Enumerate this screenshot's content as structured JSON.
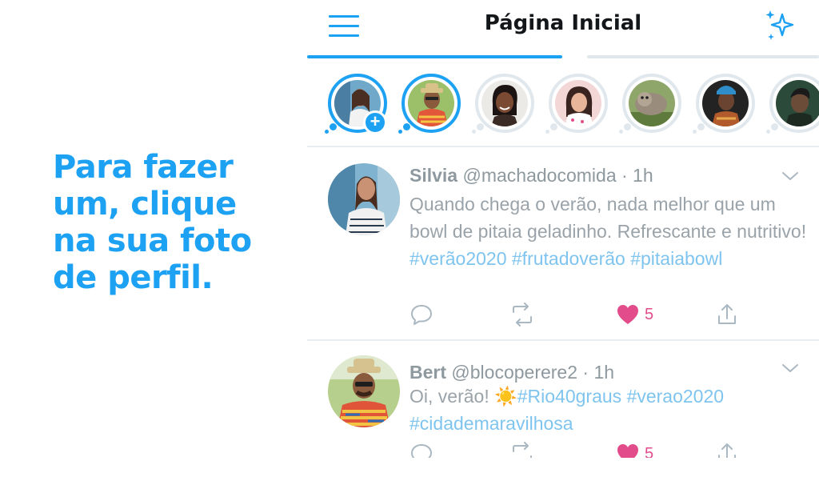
{
  "caption": {
    "line1": "Para fazer",
    "line2": "um, clique",
    "line3": "na sua foto",
    "line4": "de perfil."
  },
  "header": {
    "title": "Página Inicial",
    "menu_icon": "hamburger-menu-icon",
    "sparkle_icon": "sparkle-icon"
  },
  "colors": {
    "accent": "#1da1f2",
    "like": "#e0245e"
  },
  "fleets": [
    {
      "kind": "own",
      "badge": "+"
    },
    {
      "kind": "active"
    },
    {
      "kind": "seen"
    },
    {
      "kind": "seen"
    },
    {
      "kind": "seen"
    },
    {
      "kind": "seen"
    },
    {
      "kind": "seen"
    }
  ],
  "tweets": [
    {
      "name": "Silvia",
      "handle": "@machadocomida",
      "time": "· 1h",
      "text_before": "Quando chega o verão, nada melhor que um bowl de pitaia geladinho. Refrescante e nutritivo! ",
      "tag1": "#verão2020",
      "tag2": "#frutadoverão",
      "tag3": "#pitaiabowl",
      "likes": "5"
    },
    {
      "name": "Bert",
      "handle": "@blocoperere2",
      "time": "· 1h",
      "text_before": "Oi, verão! ",
      "emoji": "☀️",
      "tag1": "#Rio40graus",
      "tag2": "#verao2020",
      "tag3": "#cidademaravilhosa",
      "likes": "5"
    }
  ]
}
